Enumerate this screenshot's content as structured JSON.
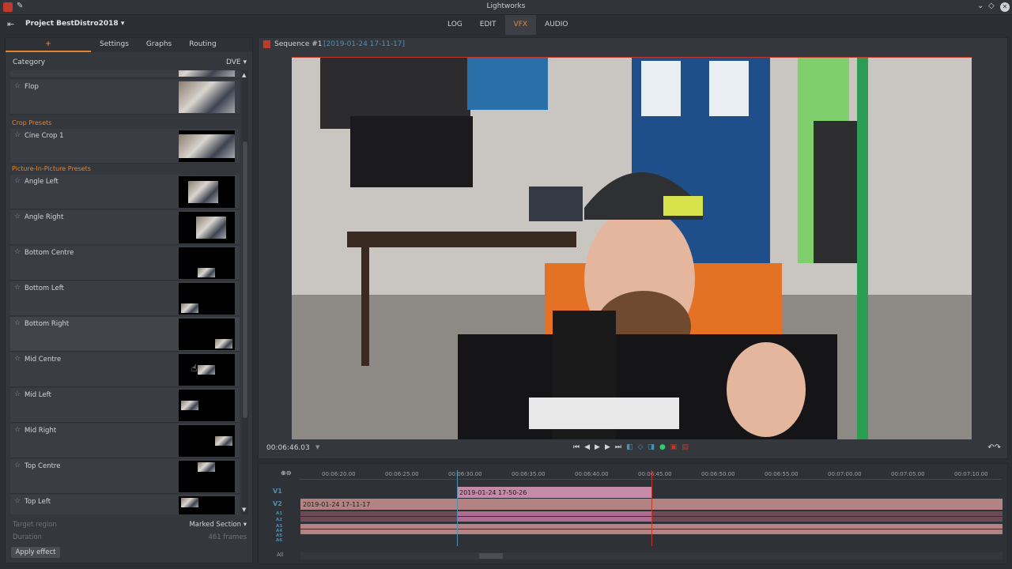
{
  "window": {
    "title": "Lightworks"
  },
  "menubar": {
    "project": "Project BestDistro2018",
    "tabs": [
      {
        "label": "LOG",
        "active": false
      },
      {
        "label": "EDIT",
        "active": false
      },
      {
        "label": "VFX",
        "active": true
      },
      {
        "label": "AUDIO",
        "active": false
      }
    ]
  },
  "left_panel": {
    "tabs": [
      {
        "label": "+"
      },
      {
        "label": "Settings"
      },
      {
        "label": "Graphs"
      },
      {
        "label": "Routing"
      }
    ],
    "category_label": "Category",
    "category_value": "DVE",
    "sections": [
      {
        "heading": "Crop Presets"
      },
      {
        "heading": "Picture-In-Picture Presets"
      }
    ],
    "effects": [
      {
        "name": "Flop"
      },
      {
        "name": "Cine Crop 1"
      },
      {
        "name": "Angle Left"
      },
      {
        "name": "Angle Right"
      },
      {
        "name": "Bottom Centre"
      },
      {
        "name": "Bottom Left"
      },
      {
        "name": "Bottom Right"
      },
      {
        "name": "Mid Centre"
      },
      {
        "name": "Mid Left"
      },
      {
        "name": "Mid Right"
      },
      {
        "name": "Top Centre"
      },
      {
        "name": "Top Left"
      }
    ],
    "target_region_label": "Target region",
    "target_region_value": "Marked Section",
    "duration_label": "Duration",
    "duration_value": "461 frames",
    "apply_label": "Apply effect"
  },
  "viewer": {
    "sequence_name": "Sequence #1",
    "sequence_time": "[2019-01-24 17-11-17]",
    "timecode": "00:06:46.03"
  },
  "timeline": {
    "ruler": [
      "00:06:20.00",
      "00:06:25.00",
      "00:06:30.00",
      "00:06:35.00",
      "00:06:40.00",
      "00:06:45.00",
      "00:06:50.00",
      "00:06:55.00",
      "00:07:00.00",
      "00:07:05.00",
      "00:07:10.00"
    ],
    "tracks": [
      "V1",
      "V2",
      "A1",
      "A2",
      "A3",
      "A4",
      "A5",
      "A6"
    ],
    "clip_v1": "2019-01-24 17-50-26",
    "clip_v2": "2019-01-24 17-11-17",
    "all_label": "All"
  },
  "colors": {
    "accent": "#e8842c",
    "playhead": "#c0392b",
    "track_label": "#4f8fb0"
  }
}
